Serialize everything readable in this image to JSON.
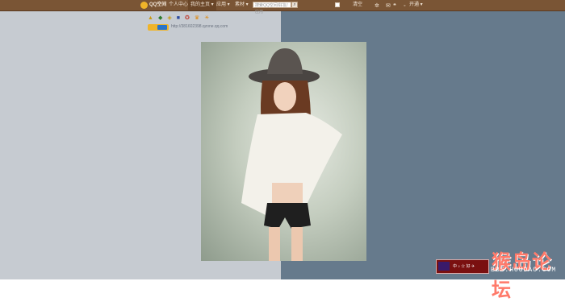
{
  "topbar": {
    "brand": "QQ空间",
    "nav": [
      "个人中心",
      "我的主页",
      "应用",
      "素材"
    ],
    "search_placeholder": "搜索QQ空间/好友/应用",
    "right_label": "清空",
    "status": "开通"
  },
  "profile": {
    "url": "http://381602398.qzone.qq.com"
  },
  "watermark": {
    "box_text": "中 ♪ ☆ 好 ✈",
    "cn_text": "猴岛论坛",
    "url_text": "BBS.HOUDAO.COM"
  }
}
